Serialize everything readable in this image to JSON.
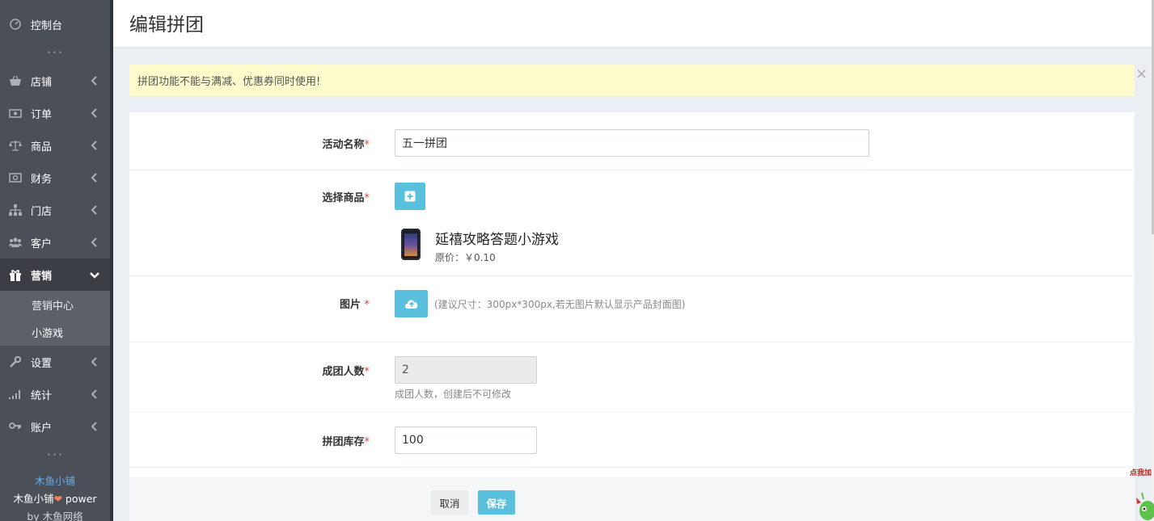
{
  "sidebar": {
    "items": [
      {
        "id": "dashboard",
        "label": "控制台",
        "icon": "gauge-icon"
      },
      {
        "id": "store",
        "label": "店铺",
        "icon": "basket-icon"
      },
      {
        "id": "order",
        "label": "订单",
        "icon": "money-bill-icon"
      },
      {
        "id": "product",
        "label": "商品",
        "icon": "scale-icon"
      },
      {
        "id": "finance",
        "label": "财务",
        "icon": "cash-icon"
      },
      {
        "id": "shop",
        "label": "门店",
        "icon": "sitemap-icon"
      },
      {
        "id": "customer",
        "label": "客户",
        "icon": "users-icon"
      },
      {
        "id": "marketing",
        "label": "营销",
        "icon": "gift-icon"
      },
      {
        "id": "settings",
        "label": "设置",
        "icon": "wrench-icon"
      },
      {
        "id": "stats",
        "label": "统计",
        "icon": "signal-icon"
      },
      {
        "id": "account",
        "label": "账户",
        "icon": "key-icon"
      }
    ],
    "marketing_sub": [
      {
        "label": "营销中心"
      },
      {
        "label": "小游戏"
      }
    ],
    "dots": "•••",
    "brand": {
      "name": "木鱼小铺",
      "line2_prefix": "木鱼小铺",
      "heart": "❤",
      "line2_suffix": " power",
      "line3": "by 木鱼网络"
    }
  },
  "header": {
    "title": "编辑拼团"
  },
  "notice": {
    "text": "拼团功能不能与满减、优惠券同时使用!",
    "close": "×"
  },
  "form": {
    "required_mark": "*",
    "activity_name": {
      "label": "活动名称",
      "value": "五一拼团"
    },
    "select_product": {
      "label": "选择商品",
      "product_name": "延禧攻略答题小游戏",
      "product_price": "原价：￥0.10"
    },
    "image": {
      "label": "图片 ",
      "hint": "(建议尺寸：300px*300px,若无图片默认显示产品封面图)"
    },
    "group_size": {
      "label": "成团人数",
      "value": "2",
      "hint": "成团人数，创建后不可修改"
    },
    "group_stock": {
      "label": "拼团库存",
      "value": "100"
    }
  },
  "footer": {
    "cancel_label": "取消",
    "save_label": "保存"
  },
  "float_widget": {
    "label": "点我加"
  },
  "colors": {
    "sidebar_bg": "#4b5058",
    "sidebar_active": "#3b3f45",
    "accent": "#5bc0de",
    "notice_bg": "#fdfbcc",
    "required": "#e0463c",
    "brand_blue": "#5aaef3"
  }
}
